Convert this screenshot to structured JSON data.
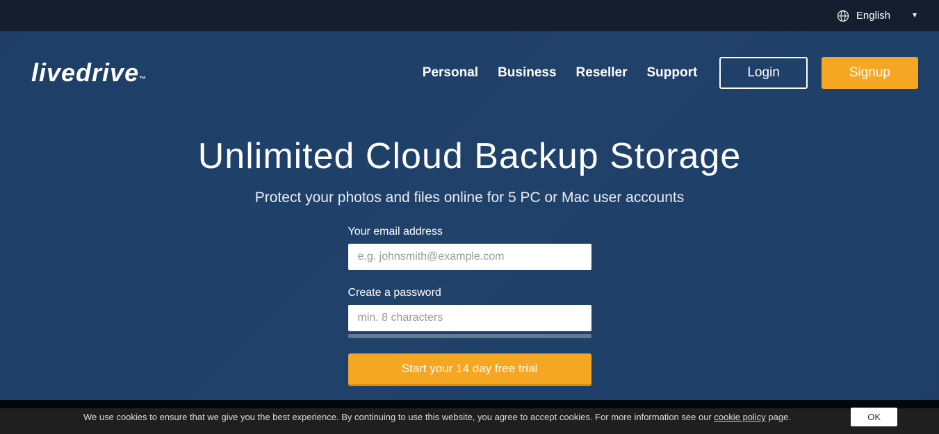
{
  "topbar": {
    "language": "English"
  },
  "logo": {
    "text": "livedrive",
    "tm": "™"
  },
  "nav": {
    "links": [
      "Personal",
      "Business",
      "Reseller",
      "Support"
    ],
    "login": "Login",
    "signup": "Signup"
  },
  "hero": {
    "title": "Unlimited Cloud Backup Storage",
    "subtitle": "Protect your photos and files online for 5 PC or Mac user accounts"
  },
  "form": {
    "email_label": "Your email address",
    "email_placeholder": "e.g. johnsmith@example.com",
    "password_label": "Create a password",
    "password_placeholder": "min. 8 characters",
    "submit": "Start your 14 day free trial"
  },
  "cookie": {
    "text_before": "We use cookies to ensure that we give you the best experience. By continuing to use this website, you agree to accept cookies. For more information see our ",
    "link": "cookie policy",
    "text_after": " page.",
    "ok": "OK"
  }
}
